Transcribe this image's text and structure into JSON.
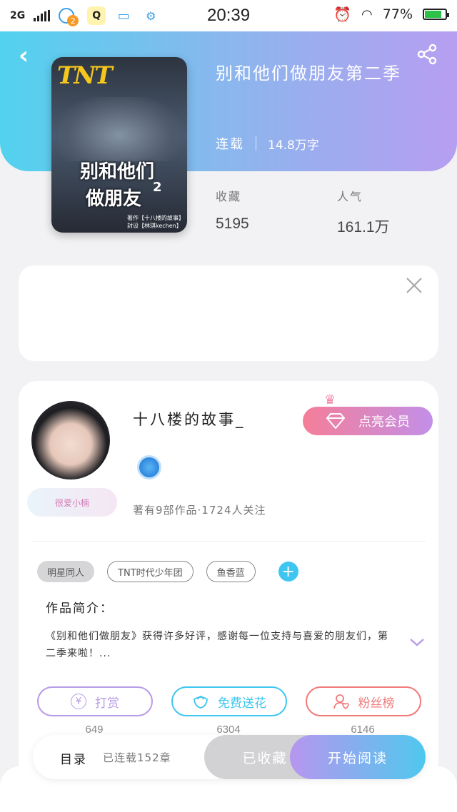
{
  "status_bar": {
    "network": "2G",
    "notif_badge": "2",
    "time": "20:39",
    "battery": "77%"
  },
  "book": {
    "title": "别和他们做朋友第二季",
    "status": "连载",
    "word_count": "14.8万字",
    "cover": {
      "logo": "TNT",
      "title_line1": "别和他们",
      "title_line2": "做朋友",
      "number": "2",
      "credit_line1": "著作【十八楼的故事】",
      "credit_line2": "封设【林琪kechen】"
    },
    "stats": [
      {
        "label": "收藏",
        "value": "5195"
      },
      {
        "label": "人气",
        "value": "161.1万"
      }
    ]
  },
  "author": {
    "name": "十八楼的故事_",
    "frame_text": "很爱小楠",
    "member_button": "点亮会员",
    "stats": "著有9部作品·1724人关注"
  },
  "tags": [
    "明星同人",
    "TNT时代少年团",
    "鱼香蓝"
  ],
  "intro": {
    "label": "作品简介：",
    "text": "《别和他们做朋友》获得许多好评，感谢每一位支持与喜爱的朋友们，第二季来啦！..."
  },
  "actions": [
    {
      "label": "打赏",
      "count": "649",
      "color": "#b79be8"
    },
    {
      "label": "免费送花",
      "count": "6304",
      "color": "#3ec6f0"
    },
    {
      "label": "粉丝榜",
      "count": "6146",
      "color": "#f07a7a"
    }
  ],
  "bottom_bar": {
    "directory": "目录",
    "chapters": "已连载152章",
    "collected": "已收藏",
    "start_read": "开始阅读"
  },
  "icons": {
    "back": "chevron-left-icon",
    "share": "share-icon",
    "close": "close-icon",
    "diamond": "diamond-icon",
    "crown": "crown-icon",
    "expand": "chevron-down-icon"
  }
}
